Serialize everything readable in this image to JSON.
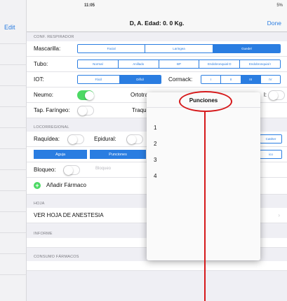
{
  "left_panel": {
    "edit_label": "Edit"
  },
  "statusbar": {
    "time": "11:05",
    "battery": "5%"
  },
  "navbar": {
    "title": "D, A. Edad: 0. 0 Kg.",
    "done_label": "Done"
  },
  "sections": {
    "respirador": "CONF. RESPIRADOR",
    "locorregional": "LOCORREGIONAL",
    "hoja": "HOJA",
    "informe": "INFORME",
    "consumo": "CONSUMO FÁRMACOS"
  },
  "rows": {
    "mascarilla": {
      "label": "Mascarilla:",
      "options": [
        "Facial",
        "Laringea",
        "Guedel"
      ],
      "selected": 2
    },
    "tubo": {
      "label": "Tubo:",
      "options": [
        "Normal",
        "Anillado",
        "BP",
        "Endobronquial D",
        "Endobronquial I"
      ]
    },
    "iot": {
      "label": "IOT:",
      "options": [
        "Fácil",
        "Difícil"
      ],
      "selected": 1,
      "cormack_label": "Cormack:",
      "cormack_options": [
        "I",
        "II",
        "III",
        "IV"
      ],
      "cormack_selected": 2
    },
    "neumo": {
      "label": "Neumo:",
      "ortotra_label": "Ortotra",
      "right_label": "l:"
    },
    "tap": {
      "label": "Tap. Faríngeo:",
      "traque_label": "Traque"
    },
    "raquidea": {
      "label": "Raquídea:",
      "epidural_label": "Epidural:",
      "cateter_label": "Catéter"
    },
    "buttons": {
      "aguja": "Aguja",
      "punciones": "Punciones",
      "right": "ico"
    },
    "bloqueo": {
      "label": "Bloqueo:",
      "placeholder": "Bloqueo"
    },
    "anadir": {
      "label": "Añadir Fármaco"
    },
    "ver_hoja": {
      "label": "VER HOJA DE ANESTESIA"
    }
  },
  "popover": {
    "title": "Punciones",
    "items": [
      "1",
      "2",
      "3",
      "4"
    ]
  },
  "colors": {
    "accent": "#2a7de1",
    "switch_on": "#4cd964",
    "annotation": "#d6191b"
  }
}
